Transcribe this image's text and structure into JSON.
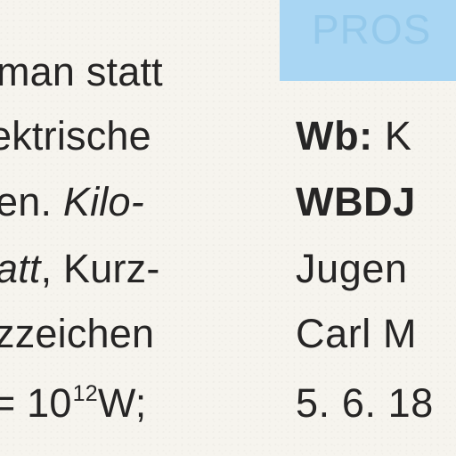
{
  "left_column": {
    "line_1": "man statt",
    "line_2": "ektrische",
    "line_3_normal": "en. ",
    "line_3_italic": "Kilo-",
    "line_4_italic": "att",
    "line_4_normal": ", Kurz-",
    "line_5": "zzeichen",
    "line_6_prefix": "= 10",
    "line_6_superscript": "12",
    "line_6_suffix": "W;"
  },
  "right_column": {
    "blue_panel_partial_text": "PROS",
    "line_1_bold": "Wb:",
    "line_1_normal": " K",
    "line_2_bold": "WBDJ",
    "line_3": "Jugen",
    "line_4": "Carl M",
    "line_5": "5. 6. 18"
  },
  "colors": {
    "paper": "#f6f4ee",
    "ink": "#262525",
    "blue_panel": "#a9d6f3"
  }
}
